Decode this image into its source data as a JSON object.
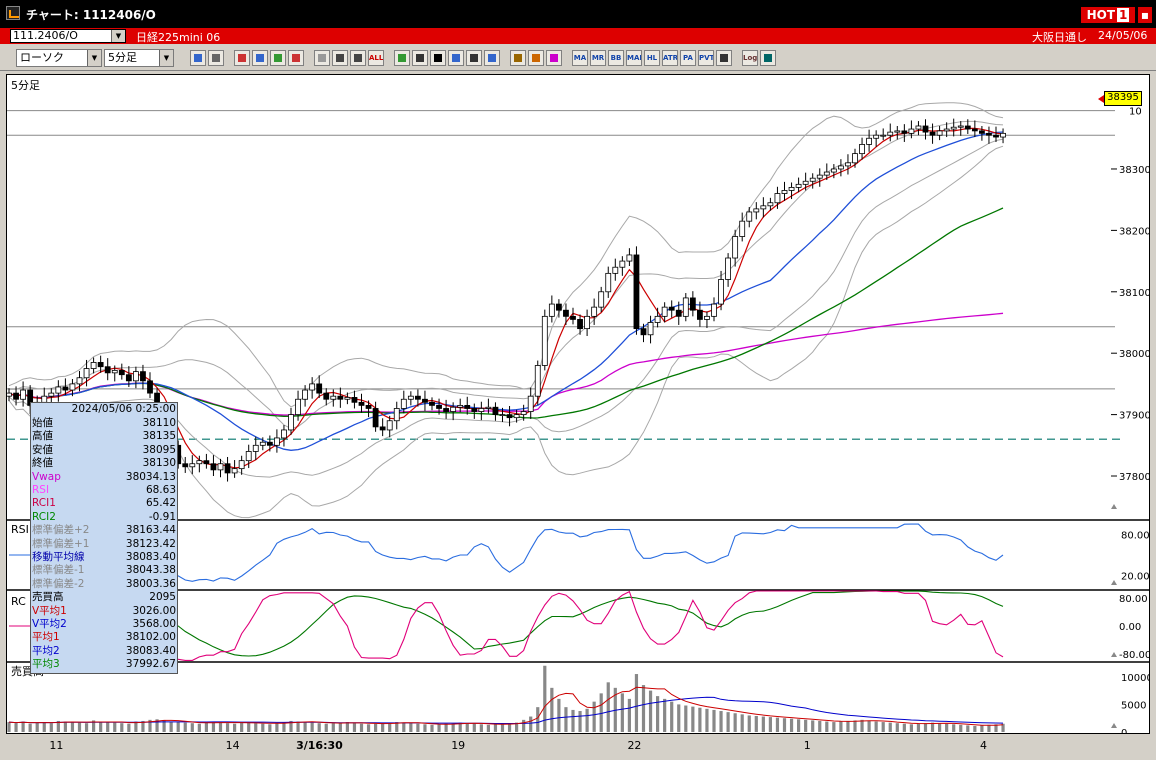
{
  "titlebar": {
    "title": "チャート: 1112406/O",
    "hot_label": "HOT",
    "hot_number": "1"
  },
  "header": {
    "code_value": "111.2406/O",
    "instrument": "日経225mini 06",
    "market": "大阪日通し",
    "date": "24/05/06"
  },
  "toolbar": {
    "chart_type": "ローソク",
    "interval": "5分足"
  },
  "icons": [
    "zoom-icon",
    "compare-icon",
    "candle-icon",
    "search-chart-icon",
    "grid-icon",
    "arrow-icon",
    "disabled-icon",
    "bar-icon",
    "bar2-icon",
    "all-icon",
    "pen-icon",
    "line-icon",
    "cursor-icon",
    "hand-icon",
    "doc-icon",
    "trash-icon",
    "grid2-icon",
    "wrench-icon",
    "color-icon",
    "ma-icon",
    "mr-icon",
    "bb-icon",
    "mae-icon",
    "hl-icon",
    "atr-icon",
    "pa-icon",
    "pvt-icon",
    "box-icon",
    "log-icon",
    "exit-icon"
  ],
  "toolbar_labels": {
    "all": "ALL",
    "ma": "MA",
    "mr": "MR",
    "bb": "BB",
    "mae": "MAE",
    "hl": "HL",
    "atr": "ATR",
    "pa": "PA",
    "pvt": "PVT",
    "log": "Log"
  },
  "panels": {
    "main_label": "5分足",
    "rsi_label": "RSI",
    "rci_label": "RC",
    "volume_label": "売買高"
  },
  "price_tag": "38395",
  "info": {
    "datetime": "2024/05/06 0:25:00",
    "rows": [
      {
        "k": "始値",
        "v": "38110",
        "c": "#000000"
      },
      {
        "k": "高値",
        "v": "38135",
        "c": "#000000"
      },
      {
        "k": "安値",
        "v": "38095",
        "c": "#000000"
      },
      {
        "k": "終値",
        "v": "38130",
        "c": "#000000"
      },
      {
        "k": "Vwap",
        "v": "38034.13",
        "c": "#cc00cc"
      },
      {
        "k": "RSI",
        "v": "68.63",
        "c": "#ff44ff"
      },
      {
        "k": "RCI1",
        "v": "65.42",
        "c": "#cc0044"
      },
      {
        "k": "RCI2",
        "v": "-0.91",
        "c": "#008800"
      },
      {
        "k": "標準偏差+2",
        "v": "38163.44",
        "c": "#888888"
      },
      {
        "k": "標準偏差+1",
        "v": "38123.42",
        "c": "#888888"
      },
      {
        "k": "移動平均線",
        "v": "38083.40",
        "c": "#0000aa"
      },
      {
        "k": "標準偏差-1",
        "v": "38043.38",
        "c": "#888888"
      },
      {
        "k": "標準偏差-2",
        "v": "38003.36",
        "c": "#888888"
      },
      {
        "k": "売買高",
        "v": "2095",
        "c": "#000000"
      },
      {
        "k": "V平均1",
        "v": "3026.00",
        "c": "#cc0000"
      },
      {
        "k": "V平均2",
        "v": "3568.00",
        "c": "#0000cc"
      },
      {
        "k": "平均1",
        "v": "38102.00",
        "c": "#cc0000"
      },
      {
        "k": "平均2",
        "v": "38083.40",
        "c": "#0000cc"
      },
      {
        "k": "平均3",
        "v": "37992.67",
        "c": "#008800"
      }
    ]
  },
  "chart_data": {
    "type": "candlestick",
    "price_axis": {
      "ylim": [
        37730,
        38440
      ],
      "ticks": [
        37800,
        37900,
        38000,
        38100,
        38200,
        38300
      ],
      "tick_labels": [
        "37800",
        "37900",
        "38000",
        "38100",
        "38200",
        "38300"
      ],
      "top_partial_label": "10"
    },
    "rsi_axis": {
      "ylim": [
        0,
        100
      ],
      "ticks": [
        80,
        20
      ],
      "tick_labels": [
        "80.00",
        "20.00"
      ]
    },
    "rci_axis": {
      "ylim": [
        -100,
        100
      ],
      "ticks": [
        80,
        0,
        -80
      ],
      "tick_labels": [
        "80.00",
        "0.00",
        "-80.00"
      ]
    },
    "volume_axis": {
      "ylim": [
        0,
        12500
      ],
      "ticks": [
        10000,
        5000,
        0
      ],
      "tick_labels": [
        "10000",
        "5000",
        "0"
      ]
    },
    "x_labels": [
      {
        "label": "11",
        "i": 7
      },
      {
        "label": "14",
        "i": 32
      },
      {
        "label": "3/16:30",
        "i": 42
      },
      {
        "label": "19",
        "i": 64
      },
      {
        "label": "22",
        "i": 89
      },
      {
        "label": "1",
        "i": 114
      },
      {
        "label": "4",
        "i": 139
      }
    ],
    "horizontal_lines": [
      38395,
      38355,
      38043,
      37942
    ],
    "dashed_line": 37860,
    "close": [
      37935,
      37925,
      37940,
      37915,
      37920,
      37930,
      37935,
      37945,
      37940,
      37950,
      37960,
      37975,
      37985,
      37978,
      37968,
      37972,
      37965,
      37955,
      37970,
      37955,
      37935,
      37905,
      37880,
      37850,
      37820,
      37815,
      37820,
      37825,
      37820,
      37810,
      37820,
      37805,
      37812,
      37825,
      37840,
      37850,
      37855,
      37850,
      37862,
      37875,
      37900,
      37925,
      37940,
      37950,
      37935,
      37925,
      37930,
      37925,
      37928,
      37920,
      37915,
      37910,
      37880,
      37875,
      37890,
      37910,
      37925,
      37930,
      37925,
      37920,
      37915,
      37910,
      37905,
      37912,
      37915,
      37910,
      37905,
      37910,
      37912,
      37900,
      37900,
      37895,
      37900,
      37905,
      37930,
      37980,
      38060,
      38080,
      38070,
      38060,
      38055,
      38040,
      38060,
      38075,
      38100,
      38130,
      38140,
      38150,
      38160,
      38040,
      38030,
      38050,
      38060,
      38075,
      38070,
      38060,
      38090,
      38070,
      38055,
      38060,
      38080,
      38120,
      38155,
      38190,
      38215,
      38230,
      38235,
      38240,
      38245,
      38260,
      38265,
      38270,
      38275,
      38280,
      38285,
      38290,
      38295,
      38300,
      38305,
      38310,
      38325,
      38340,
      38350,
      38355,
      38355,
      38360,
      38362,
      38358,
      38365,
      38370,
      38360,
      38355,
      38362,
      38365,
      38368,
      38370,
      38365,
      38362,
      38358,
      38355,
      38352,
      38358
    ],
    "volume": [
      1800,
      1600,
      1900,
      1500,
      1700,
      1800,
      1600,
      2000,
      1900,
      1800,
      1700,
      1600,
      2100,
      1900,
      1800,
      1700,
      1600,
      1500,
      1900,
      2000,
      2200,
      2300,
      2100,
      1900,
      1800,
      1700,
      1600,
      1500,
      1700,
      1900,
      1800,
      1600,
      1500,
      1700,
      1800,
      1600,
      1500,
      1400,
      1600,
      1800,
      2000,
      1900,
      1800,
      1700,
      1600,
      1500,
      1600,
      1700,
      1800,
      1600,
      1500,
      1400,
      1500,
      1600,
      1700,
      1800,
      1700,
      1600,
      1500,
      1400,
      1300,
      1400,
      1500,
      1600,
      1700,
      1600,
      1500,
      1400,
      1300,
      1400,
      1500,
      1600,
      1700,
      2200,
      2800,
      4500,
      12000,
      8000,
      6000,
      4500,
      4000,
      3800,
      4200,
      5500,
      7000,
      9000,
      8000,
      7000,
      6000,
      10500,
      8500,
      7500,
      6500,
      6000,
      5500,
      5000,
      4800,
      4600,
      4400,
      4200,
      4000,
      3800,
      3600,
      3400,
      3200,
      3000,
      2900,
      2800,
      2700,
      2600,
      2500,
      2400,
      2300,
      2200,
      2100,
      2000,
      1900,
      1800,
      1900,
      2000,
      2100,
      2200,
      2000,
      1900,
      1800,
      1700,
      1600,
      1500,
      1400,
      1500,
      1600,
      1700,
      1600,
      1500,
      1400,
      1300,
      1200,
      1100,
      1200,
      1300,
      1400,
      1500
    ],
    "series": [
      {
        "name": "移動平均線",
        "color": "#1f4fd8"
      },
      {
        "name": "平均3",
        "color": "#007700"
      },
      {
        "name": "Vwap",
        "color": "#cc00cc"
      },
      {
        "name": "RSI",
        "color": "#2a6de0"
      },
      {
        "name": "RCI1",
        "color": "#e0007a"
      },
      {
        "name": "RCI2",
        "color": "#007700"
      }
    ]
  }
}
